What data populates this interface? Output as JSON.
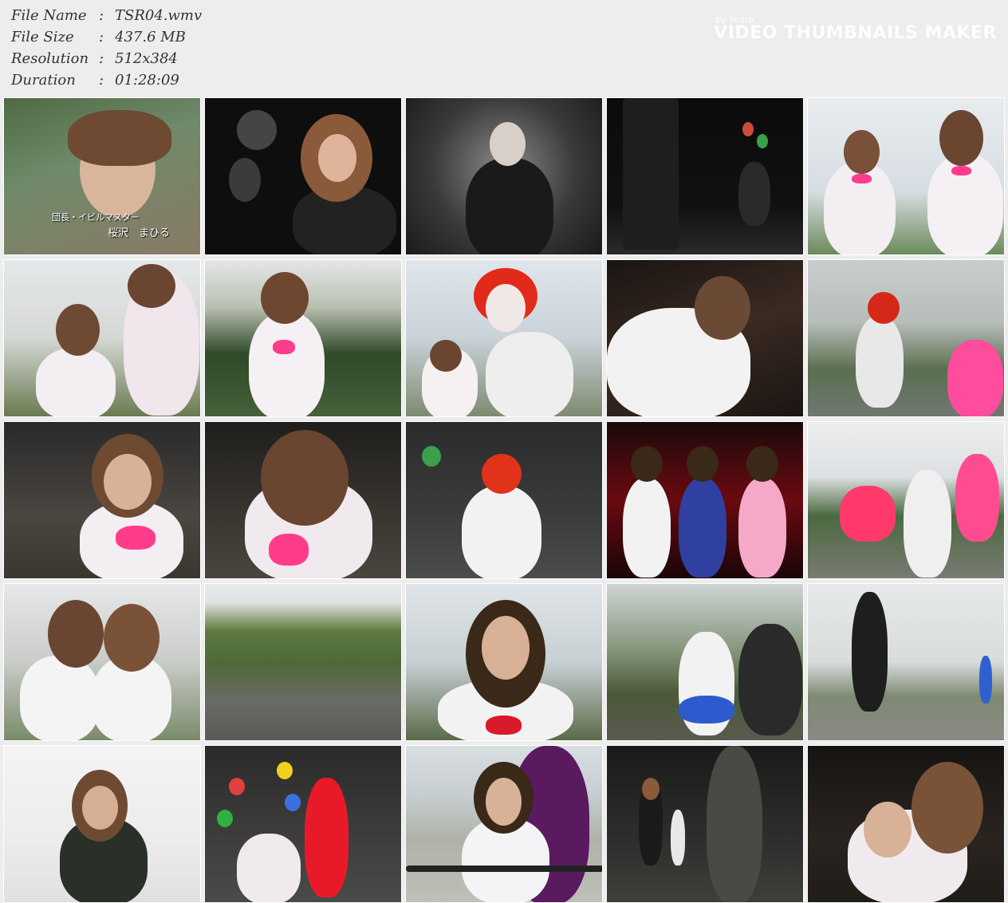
{
  "info": {
    "rows": [
      {
        "label": "File Name",
        "value": "TSR04.wmv"
      },
      {
        "label": "File Size",
        "value": "437.6 MB"
      },
      {
        "label": "Resolution",
        "value": "512x384"
      },
      {
        "label": "Duration",
        "value": "01:28:09"
      }
    ],
    "colon": ":"
  },
  "watermark": {
    "by": "by Scorp",
    "title": "VIDEO THUMBNAILS MAKER"
  },
  "thumbnail_caption": {
    "line1": "団長・イビルマスター",
    "line2": "桜沢　まひる"
  },
  "colors": {
    "background": "#ededed",
    "border": "#ffffff"
  }
}
